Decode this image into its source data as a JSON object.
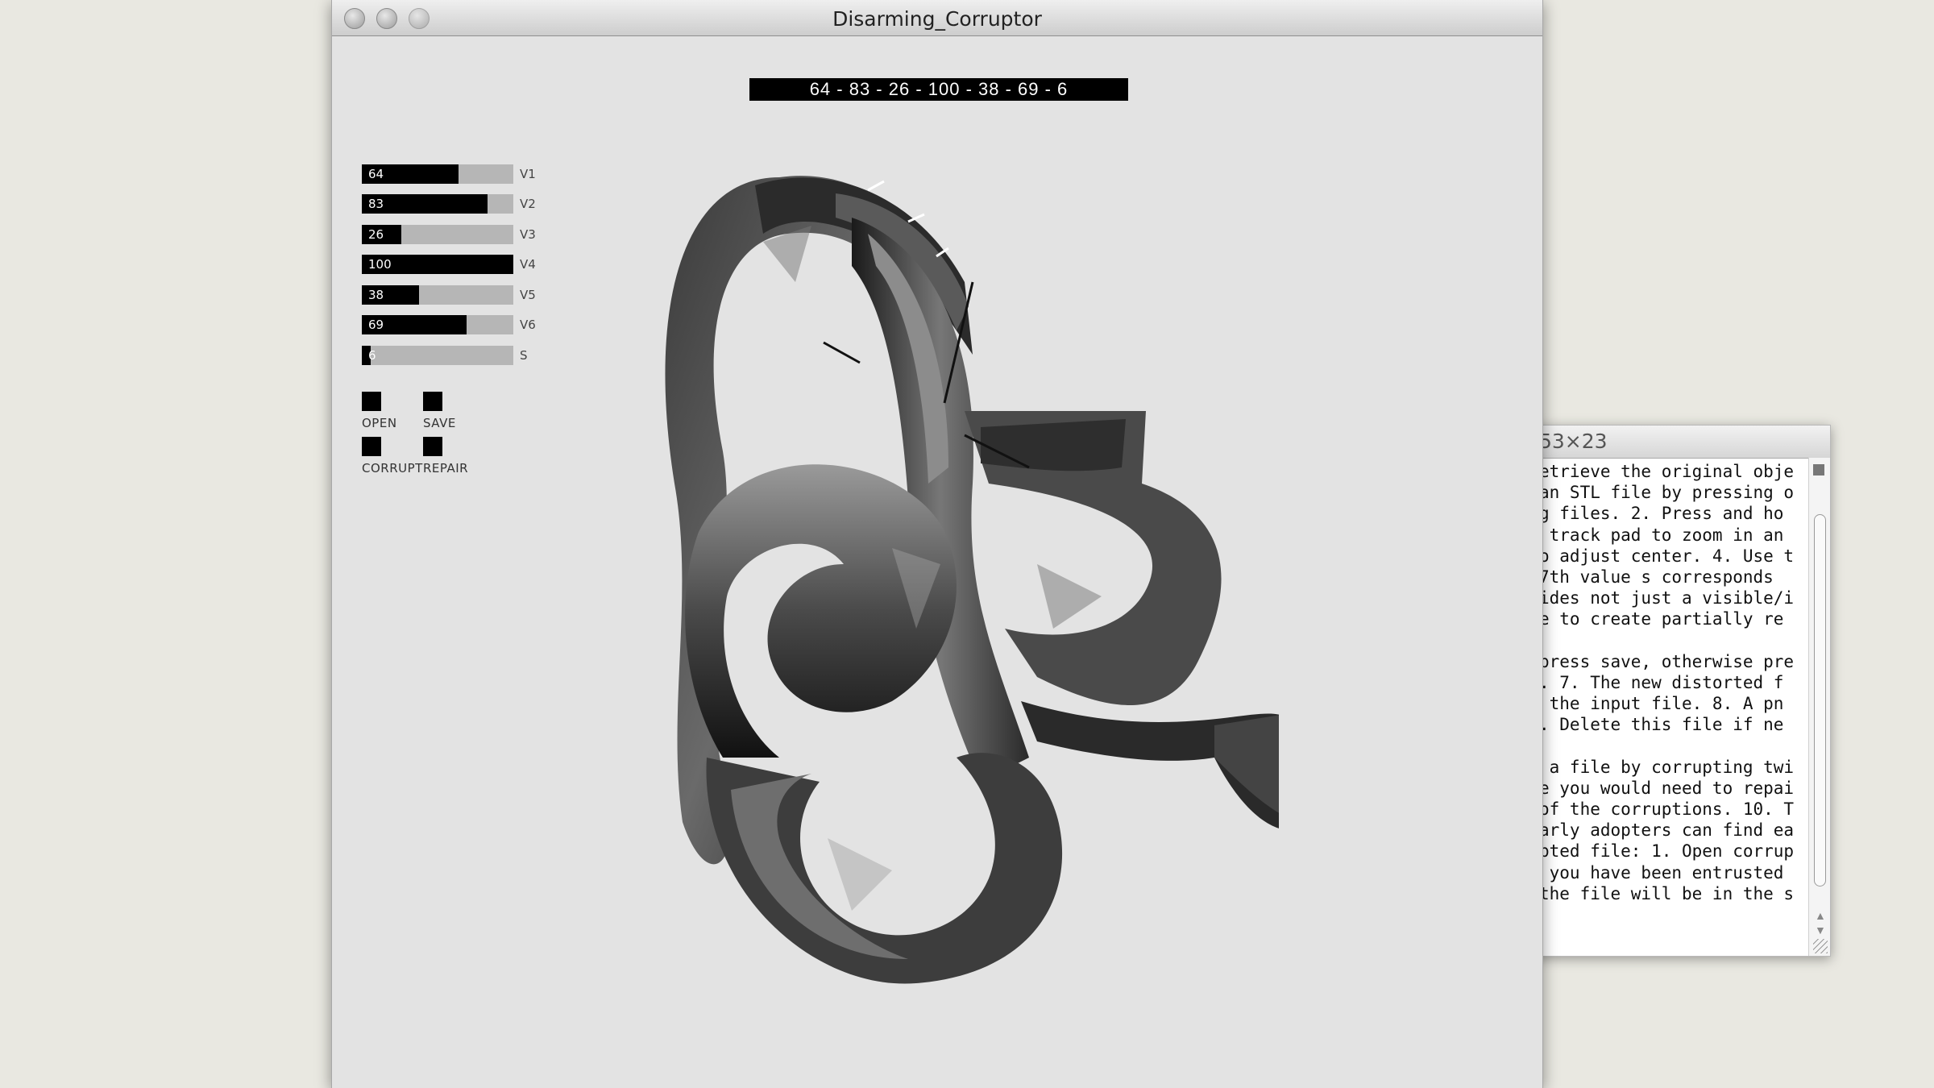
{
  "terminal_window": {
    "title": "53×23",
    "lines": [
      "etrieve the original obje",
      "an STL file by pressing o",
      "g files. 2. Press and ho",
      " track pad to zoom in an",
      "o adjust center. 4. Use t",
      "7th value s corresponds",
      "ides not just a visible/i",
      "e to create partially re",
      "",
      "press save, otherwise pre",
      ". 7. The new distorted f",
      " the input file. 8. A pn",
      ". Delete this file if ne",
      "",
      " a file by corrupting twi",
      "e you would need to repai",
      "of the corruptions. 10. T",
      "arly adopters can find ea",
      "pted file: 1. Open corrup",
      " you have been entrusted",
      "the file will be in the s"
    ]
  },
  "main_window": {
    "title": "Disarming_Corruptor",
    "values_display": "64 - 83 - 26 - 100 - 38 - 69 - 6"
  },
  "sliders": [
    {
      "label": "V1",
      "value": 64,
      "fraction": 0.64
    },
    {
      "label": "V2",
      "value": 83,
      "fraction": 0.83
    },
    {
      "label": "V3",
      "value": 26,
      "fraction": 0.26
    },
    {
      "label": "V4",
      "value": 100,
      "fraction": 1.0
    },
    {
      "label": "V5",
      "value": 38,
      "fraction": 0.38
    },
    {
      "label": "V6",
      "value": 69,
      "fraction": 0.69
    },
    {
      "label": "S",
      "value": 6,
      "fraction": 0.06
    }
  ],
  "buttons": {
    "open": "OPEN",
    "save": "SAVE",
    "corrupt": "CORRUPT",
    "repair": "REPAIR"
  },
  "colors": {
    "slider_fill": "#000000",
    "slider_track": "#b6b6b6",
    "canvas_background": "#e3e3e3"
  }
}
